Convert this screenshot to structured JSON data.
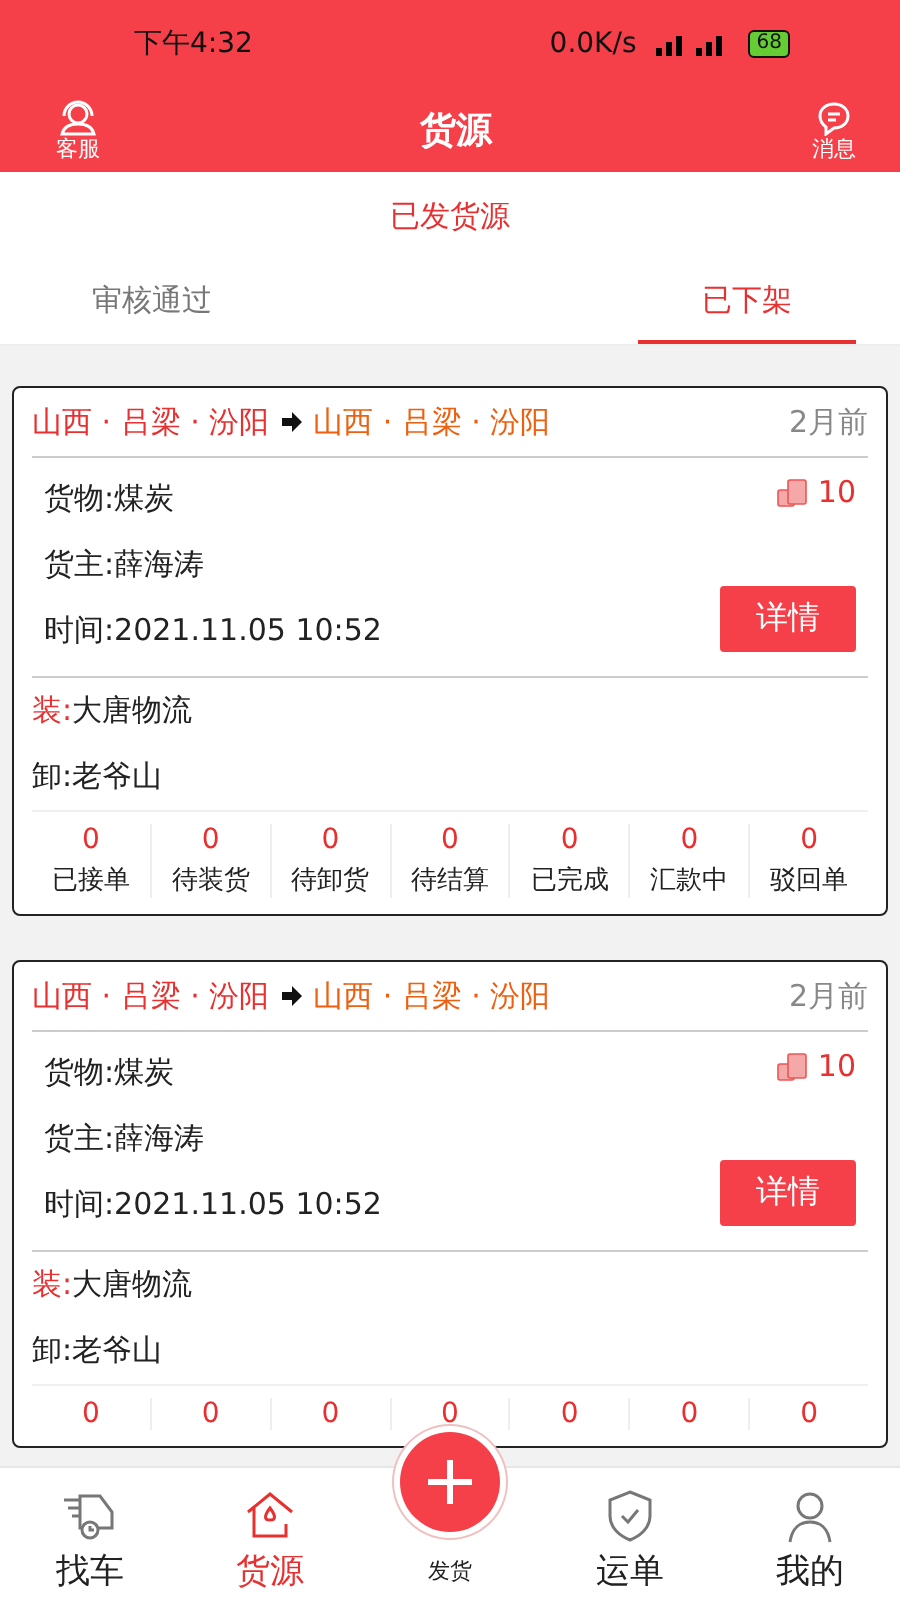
{
  "status_bar": {
    "time": "下午4:32",
    "speed": "0.0K/s",
    "battery": "68"
  },
  "header": {
    "left": "客服",
    "title": "货源",
    "right": "消息"
  },
  "subtitle": "已发货源",
  "tabs": [
    {
      "label": "审核通过",
      "selected": false
    },
    {
      "label": "已下架",
      "selected": true
    }
  ],
  "cards": [
    {
      "from": "山西 · 吕梁 · 汾阳",
      "to": "山西 · 吕梁 · 汾阳",
      "age": "2月前",
      "goods": "货物:煤炭",
      "owner": "货主:薛海涛",
      "time": "时间:2021.11.05 10:52",
      "amount": "10",
      "button": "详情",
      "load_label": "装:",
      "load": "大唐物流",
      "unload": "卸:老爷山",
      "stats": [
        {
          "count": "0",
          "label": "已接单"
        },
        {
          "count": "0",
          "label": "待装货"
        },
        {
          "count": "0",
          "label": "待卸货"
        },
        {
          "count": "0",
          "label": "待结算"
        },
        {
          "count": "0",
          "label": "已完成"
        },
        {
          "count": "0",
          "label": "汇款中"
        },
        {
          "count": "0",
          "label": "驳回单"
        }
      ]
    },
    {
      "from": "山西 · 吕梁 · 汾阳",
      "to": "山西 · 吕梁 · 汾阳",
      "age": "2月前",
      "goods": "货物:煤炭",
      "owner": "货主:薛海涛",
      "time": "时间:2021.11.05 10:52",
      "amount": "10",
      "button": "详情",
      "load_label": "装:",
      "load": "大唐物流",
      "unload": "卸:老爷山",
      "stats": [
        {
          "count": "0"
        },
        {
          "count": "0"
        },
        {
          "count": "0"
        },
        {
          "count": "0"
        },
        {
          "count": "0"
        },
        {
          "count": "0"
        },
        {
          "count": "0"
        }
      ]
    }
  ],
  "nav": [
    {
      "kind": "truck",
      "label": "找车",
      "selected": false
    },
    {
      "kind": "house",
      "label": "货源",
      "selected": true
    },
    {
      "kind": "plus",
      "label": "发货",
      "selected": false
    },
    {
      "kind": "shield",
      "label": "运单",
      "selected": false
    },
    {
      "kind": "person",
      "label": "我的",
      "selected": false
    }
  ]
}
